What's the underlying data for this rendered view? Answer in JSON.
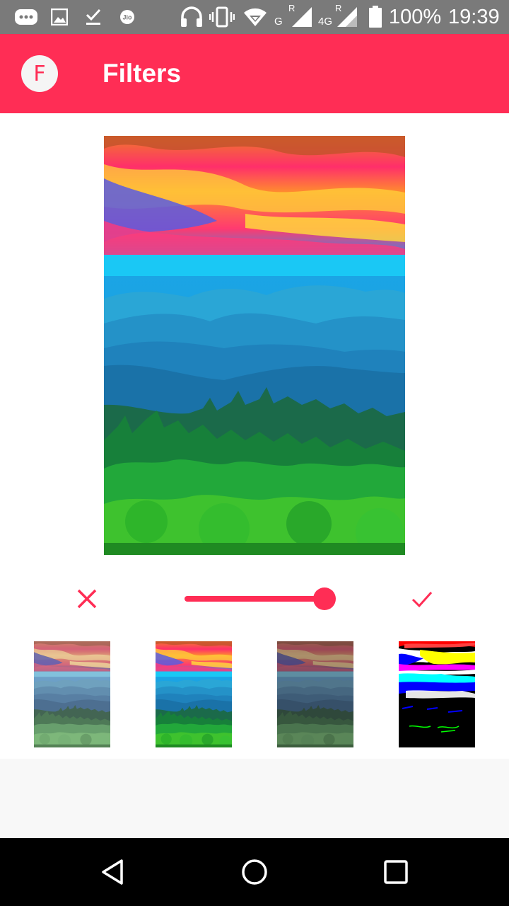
{
  "status_bar": {
    "network_g": "G",
    "roaming_1": "R",
    "network_4g": "4G",
    "roaming_2": "R",
    "battery": "100%",
    "time": "19:39",
    "icons": [
      "chat-bubble-icon",
      "gallery-icon",
      "download-done-icon",
      "jio-icon",
      "headset-icon",
      "vibrate-icon",
      "wifi-icon",
      "signal-icon",
      "battery-icon"
    ]
  },
  "app_bar": {
    "logo_letter": "F",
    "title": "Filters"
  },
  "editor": {
    "intensity_slider_value": 1.0,
    "cancel_icon": "close-icon",
    "confirm_icon": "check-icon"
  },
  "filters": [
    "original",
    "saturated",
    "dark",
    "posterize"
  ],
  "colors": {
    "status_bar_bg": "#7a7a7a",
    "primary": "#ff2d55",
    "white": "#ffffff",
    "nav_bar_bg": "#000000"
  },
  "nav_bar": {
    "icons": [
      "back-icon",
      "home-icon",
      "recents-icon"
    ]
  }
}
